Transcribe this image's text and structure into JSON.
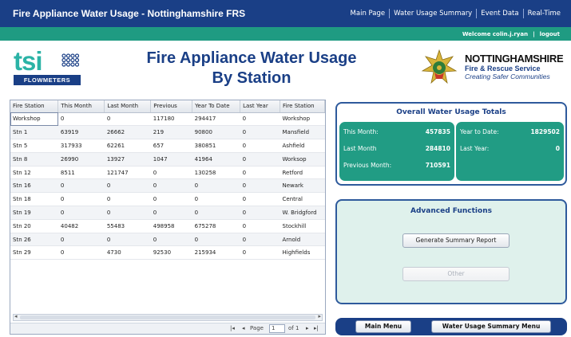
{
  "app_title": "Fire Appliance Water Usage - Nottinghamshire FRS",
  "nav": [
    {
      "label": "Main Page"
    },
    {
      "label": "Water Usage Summary"
    },
    {
      "label": "Event Data"
    },
    {
      "label": "Real-Time"
    }
  ],
  "user": {
    "welcome": "Welcome colin.j.ryan",
    "divider": "|",
    "logout": "logout"
  },
  "logo": {
    "tsi": "tsi",
    "flowmeters": "FLOWMETERS"
  },
  "page_title": {
    "line1": "Fire Appliance Water Usage",
    "line2": "By Station"
  },
  "org": {
    "name": "NOTTINGHAMSHIRE",
    "service": "Fire & Rescue Service",
    "tagline": "Creating Safer Communities"
  },
  "table": {
    "columns": [
      "Fire Station",
      "This Month",
      "Last Month",
      "Previous",
      "Year To Date",
      "Last Year",
      "Fire Station"
    ],
    "rows": [
      [
        "Workshop",
        "0",
        "0",
        "117180",
        "294417",
        "0",
        "Workshop"
      ],
      [
        "Stn 1",
        "63919",
        "26662",
        "219",
        "90800",
        "0",
        "Mansfield"
      ],
      [
        "Stn 5",
        "317933",
        "62261",
        "657",
        "380851",
        "0",
        "Ashfield"
      ],
      [
        "Stn 8",
        "26990",
        "13927",
        "1047",
        "41964",
        "0",
        "Worksop"
      ],
      [
        "Stn 12",
        "8511",
        "121747",
        "0",
        "130258",
        "0",
        "Retford"
      ],
      [
        "Stn 16",
        "0",
        "0",
        "0",
        "0",
        "0",
        "Newark"
      ],
      [
        "Stn 18",
        "0",
        "0",
        "0",
        "0",
        "0",
        "Central"
      ],
      [
        "Stn 19",
        "0",
        "0",
        "0",
        "0",
        "0",
        "W. Bridgford"
      ],
      [
        "Stn 20",
        "40482",
        "55483",
        "498958",
        "675278",
        "0",
        "Stockhill"
      ],
      [
        "Stn 26",
        "0",
        "0",
        "0",
        "0",
        "0",
        "Arnold"
      ],
      [
        "Stn 29",
        "0",
        "4730",
        "92530",
        "215934",
        "0",
        "Highfields"
      ]
    ]
  },
  "pager": {
    "first": "|◂",
    "prev": "◂",
    "page_label": "Page",
    "page_value": "1",
    "of_label": "of 1",
    "next": "▸",
    "last": "▸|"
  },
  "totals": {
    "title": "Overall Water Usage Totals",
    "this_month_label": "This Month:",
    "this_month_value": "457835",
    "last_month_label": "Last Month",
    "last_month_value": "284810",
    "previous_month_label": "Previous Month:",
    "previous_month_value": "710591",
    "ytd_label": "Year to Date:",
    "ytd_value": "1829502",
    "last_year_label": "Last Year:",
    "last_year_value": "0"
  },
  "advanced": {
    "title": "Advanced Functions",
    "generate": "Generate Summary Report",
    "other": "Other"
  },
  "bottom": {
    "main_menu": "Main Menu",
    "summary_menu": "Water Usage Summary Menu"
  }
}
